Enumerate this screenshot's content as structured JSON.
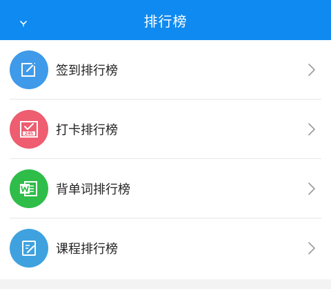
{
  "header": {
    "title": "排行榜",
    "back_icon": "chevron-down-icon",
    "background": "#0f8af0"
  },
  "rankings": [
    {
      "label": "签到排行榜",
      "icon": "checkin-edit-icon",
      "color": "#3f9ae9"
    },
    {
      "label": "打卡排行榜",
      "icon": "clock-24h-check-icon",
      "color": "#ee5d70"
    },
    {
      "label": "背单词排行榜",
      "icon": "word-document-icon",
      "color": "#2fbd4a"
    },
    {
      "label": "课程排行榜",
      "icon": "course-notebook-icon",
      "color": "#3fa2df"
    }
  ],
  "badge_text": {
    "clock": "24h"
  }
}
